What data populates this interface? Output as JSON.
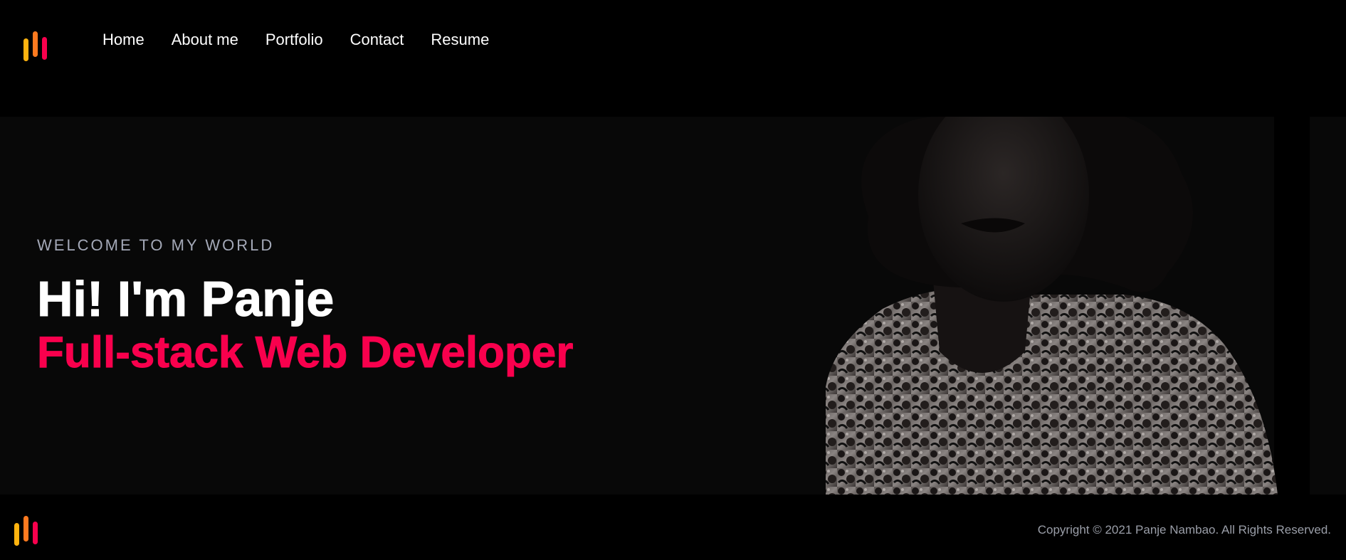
{
  "brand": {
    "logo_icon": "bars-logo-icon",
    "colors": {
      "yellow": "#ffb30f",
      "orange": "#ff7a1f",
      "red": "#f9004d"
    }
  },
  "nav": {
    "items": [
      {
        "label": "Home"
      },
      {
        "label": "About me"
      },
      {
        "label": "Portfolio"
      },
      {
        "label": "Contact"
      },
      {
        "label": "Resume"
      }
    ]
  },
  "hero": {
    "kicker": "WELCOME TO MY WORLD",
    "title": "Hi! I'm Panje",
    "subtitle": "Full-stack Web Developer",
    "accent_color": "#f9004d",
    "image": "portrait-photo"
  },
  "footer": {
    "copyright": "Copyright © 2021 Panje Nambao. All Rights Reserved."
  }
}
